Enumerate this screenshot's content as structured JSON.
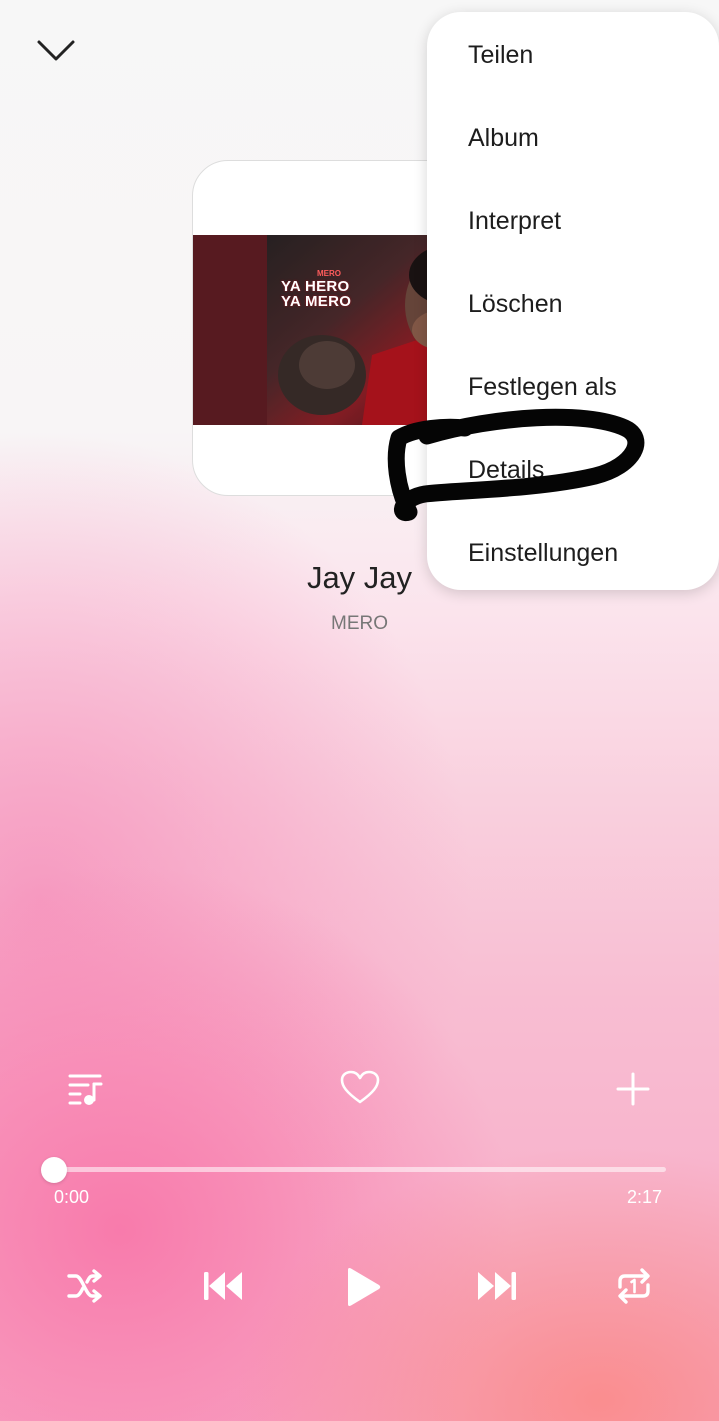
{
  "player": {
    "song_title": "Jay Jay",
    "artist": "MERO",
    "elapsed": "0:00",
    "duration": "2:17",
    "progress_fraction": 0.0
  },
  "album_art": {
    "line1": "YA HERO",
    "line2": "YA MERO",
    "artist_mini": "MERO"
  },
  "menu": {
    "items": [
      "Teilen",
      "Album",
      "Interpret",
      "Löschen",
      "Festlegen als",
      "Details",
      "Einstellungen"
    ]
  },
  "icons": {
    "collapse": "chevron-down-icon",
    "playlist": "queue-music-icon",
    "favorite": "heart-outline-icon",
    "add": "plus-icon",
    "shuffle": "shuffle-icon",
    "previous": "skip-previous-icon",
    "play": "play-icon",
    "next": "skip-next-icon",
    "repeat": "repeat-one-icon"
  },
  "colors": {
    "accent_white": "#ffffff",
    "highlight_marker": "#000000"
  }
}
